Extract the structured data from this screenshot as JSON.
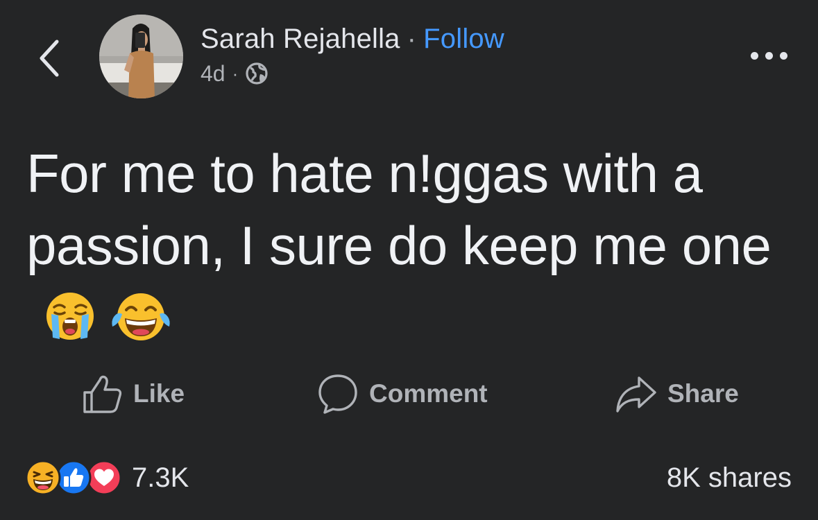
{
  "header": {
    "author_name": "Sarah Rejahella",
    "separator": "·",
    "follow_label": "Follow",
    "timestamp": "4d",
    "meta_separator": "·",
    "privacy_icon": "globe-icon",
    "back_icon": "chevron-left-icon",
    "more_icon": "more-horizontal-icon"
  },
  "post": {
    "text": "For me to hate n!ggas with a passion, I sure do keep me one",
    "emojis": [
      "loudly-crying-face",
      "face-with-tears-of-joy"
    ]
  },
  "actions": {
    "like_label": "Like",
    "comment_label": "Comment",
    "share_label": "Share"
  },
  "footer": {
    "reactions": [
      "haha",
      "like",
      "love"
    ],
    "reaction_count": "7.3K",
    "shares": "8K shares"
  },
  "colors": {
    "background": "#242526",
    "text_primary": "#e4e6eb",
    "text_secondary": "#b0b3b8",
    "follow_link": "#4599ff",
    "like_reaction": "#1877f2",
    "love_reaction": "#f33e58",
    "haha_reaction": "#f7b125"
  }
}
